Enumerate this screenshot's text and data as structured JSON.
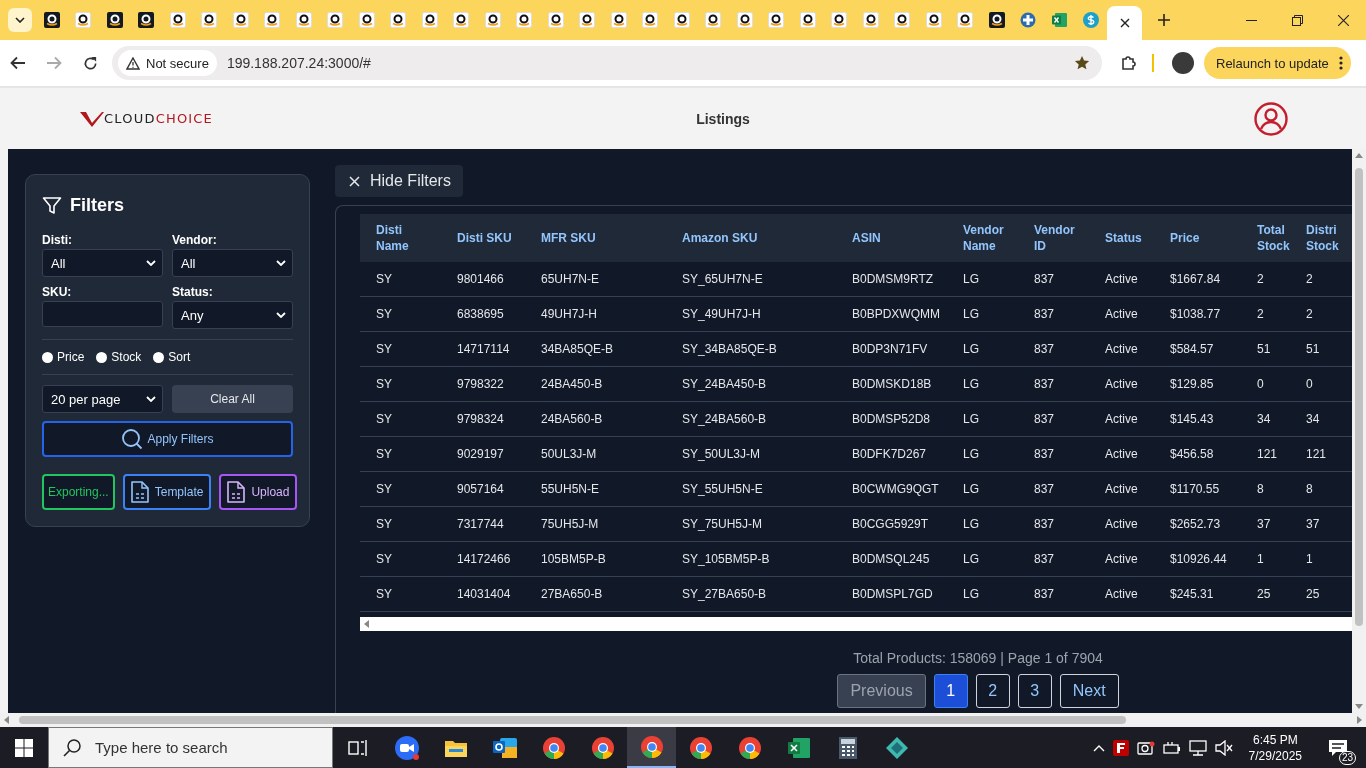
{
  "browser": {
    "tabs": [
      {
        "kind": "amazon-dark",
        "selected": false
      },
      {
        "kind": "amazon",
        "selected": false
      },
      {
        "kind": "amazon-dark",
        "selected": false
      },
      {
        "kind": "amazon-dark",
        "selected": false
      },
      {
        "kind": "amazon",
        "selected": false
      },
      {
        "kind": "amazon",
        "selected": false
      },
      {
        "kind": "amazon",
        "selected": false
      },
      {
        "kind": "amazon",
        "selected": false
      },
      {
        "kind": "amazon",
        "selected": false
      },
      {
        "kind": "amazon",
        "selected": false
      },
      {
        "kind": "amazon",
        "selected": false
      },
      {
        "kind": "amazon",
        "selected": false
      },
      {
        "kind": "amazon",
        "selected": false
      },
      {
        "kind": "amazon",
        "selected": false
      },
      {
        "kind": "amazon",
        "selected": false
      },
      {
        "kind": "amazon",
        "selected": false
      },
      {
        "kind": "amazon",
        "selected": false
      },
      {
        "kind": "amazon",
        "selected": false
      },
      {
        "kind": "amazon",
        "selected": false
      },
      {
        "kind": "amazon",
        "selected": false
      },
      {
        "kind": "amazon",
        "selected": false
      },
      {
        "kind": "amazon",
        "selected": false
      },
      {
        "kind": "amazon",
        "selected": false
      },
      {
        "kind": "amazon",
        "selected": false
      },
      {
        "kind": "amazon",
        "selected": false
      },
      {
        "kind": "amazon",
        "selected": false
      },
      {
        "kind": "amazon",
        "selected": false
      },
      {
        "kind": "amazon",
        "selected": false
      },
      {
        "kind": "amazon",
        "selected": false
      },
      {
        "kind": "amazon",
        "selected": false
      },
      {
        "kind": "amazon-dark",
        "selected": false
      },
      {
        "kind": "globe",
        "selected": false
      },
      {
        "kind": "excel",
        "selected": false
      },
      {
        "kind": "dollar",
        "selected": false
      },
      {
        "kind": "blank",
        "selected": true
      }
    ],
    "security": "Not secure",
    "url": "199.188.207.24:3000/#",
    "update_button": "Relaunch to update"
  },
  "header": {
    "logo": {
      "dark": "CLOUD",
      "red": "CHOICE"
    },
    "nav": "Listings"
  },
  "filters": {
    "title": "Filters",
    "fields": [
      {
        "label": "Disti:",
        "kind": "select",
        "value": "All"
      },
      {
        "label": "Vendor:",
        "kind": "select",
        "value": "All"
      },
      {
        "label": "SKU:",
        "kind": "input"
      },
      {
        "label": "Status:",
        "kind": "select",
        "value": "Any"
      }
    ],
    "options": [
      {
        "label": "Price",
        "selected": false
      },
      {
        "label": "Stock",
        "selected": false
      },
      {
        "label": "Sort",
        "selected": false
      }
    ],
    "per_page": "20 per page",
    "clear": "Clear All",
    "apply": "Apply Filters",
    "actions": [
      {
        "label": "Exporting...",
        "kind": "text",
        "color": "#22c55e"
      },
      {
        "label": "Template",
        "kind": "file",
        "color": "#3b82f6"
      },
      {
        "label": "Upload",
        "kind": "file",
        "color": "#a855f7"
      }
    ]
  },
  "hide_filters": "Hide Filters",
  "table": {
    "columns": [
      "Disti Name",
      "Disti SKU",
      "MFR SKU",
      "Amazon SKU",
      "ASIN",
      "Vendor Name",
      "Vendor ID",
      "Status",
      "Price",
      "Total Stock",
      "Distri Stock"
    ],
    "rows": [
      [
        "SY",
        "9801466",
        "65UH7N-E",
        "SY_65UH7N-E",
        "B0DMSM9RTZ",
        "LG",
        "837",
        "Active",
        "$1667.84",
        "2",
        "2"
      ],
      [
        "SY",
        "6838695",
        "49UH7J-H",
        "SY_49UH7J-H",
        "B0BPDXWQMM",
        "LG",
        "837",
        "Active",
        "$1038.77",
        "2",
        "2"
      ],
      [
        "SY",
        "14717114",
        "34BA85QE-B",
        "SY_34BA85QE-B",
        "B0DP3N71FV",
        "LG",
        "837",
        "Active",
        "$584.57",
        "51",
        "51"
      ],
      [
        "SY",
        "9798322",
        "24BA450-B",
        "SY_24BA450-B",
        "B0DMSKD18B",
        "LG",
        "837",
        "Active",
        "$129.85",
        "0",
        "0"
      ],
      [
        "SY",
        "9798324",
        "24BA560-B",
        "SY_24BA560-B",
        "B0DMSP52D8",
        "LG",
        "837",
        "Active",
        "$145.43",
        "34",
        "34"
      ],
      [
        "SY",
        "9029197",
        "50UL3J-M",
        "SY_50UL3J-M",
        "B0DFK7D267",
        "LG",
        "837",
        "Active",
        "$456.58",
        "121",
        "121"
      ],
      [
        "SY",
        "9057164",
        "55UH5N-E",
        "SY_55UH5N-E",
        "B0CWMG9QGT",
        "LG",
        "837",
        "Active",
        "$1170.55",
        "8",
        "8"
      ],
      [
        "SY",
        "7317744",
        "75UH5J-M",
        "SY_75UH5J-M",
        "B0CGG5929T",
        "LG",
        "837",
        "Active",
        "$2652.73",
        "37",
        "37"
      ],
      [
        "SY",
        "14172466",
        "105BM5P-B",
        "SY_105BM5P-B",
        "B0DMSQL245",
        "LG",
        "837",
        "Active",
        "$10926.44",
        "1",
        "1"
      ],
      [
        "SY",
        "14031404",
        "27BA650-B",
        "SY_27BA650-B",
        "B0DMSPL7GD",
        "LG",
        "837",
        "Active",
        "$245.31",
        "25",
        "25"
      ]
    ]
  },
  "summary": "Total Products: 158069 | Page 1 of 7904",
  "pagination": [
    {
      "label": "Previous",
      "kind": "nav",
      "disabled": true
    },
    {
      "label": "1",
      "kind": "page",
      "selected": true,
      "disabled": false
    },
    {
      "label": "2",
      "kind": "page",
      "selected": false,
      "disabled": false
    },
    {
      "label": "3",
      "kind": "page",
      "selected": false,
      "disabled": false
    },
    {
      "label": "Next",
      "kind": "nav",
      "disabled": false
    }
  ],
  "taskbar": {
    "search": {
      "placeholder": "Type here to search"
    },
    "apps": [
      {
        "kind": "taskview",
        "selected": false
      },
      {
        "kind": "zoom",
        "selected": false
      },
      {
        "kind": "folder",
        "selected": false
      },
      {
        "kind": "mail",
        "selected": false
      },
      {
        "kind": "chrome",
        "selected": false
      },
      {
        "kind": "chrome",
        "selected": false
      },
      {
        "kind": "chrome",
        "selected": true
      },
      {
        "kind": "chrome",
        "selected": false
      },
      {
        "kind": "chrome",
        "selected": false
      },
      {
        "kind": "excel",
        "selected": false
      },
      {
        "kind": "calculator",
        "selected": false
      },
      {
        "kind": "diamond",
        "selected": false
      }
    ],
    "time": "6:45 PM",
    "date": "7/29/2025",
    "notifications": "23"
  }
}
